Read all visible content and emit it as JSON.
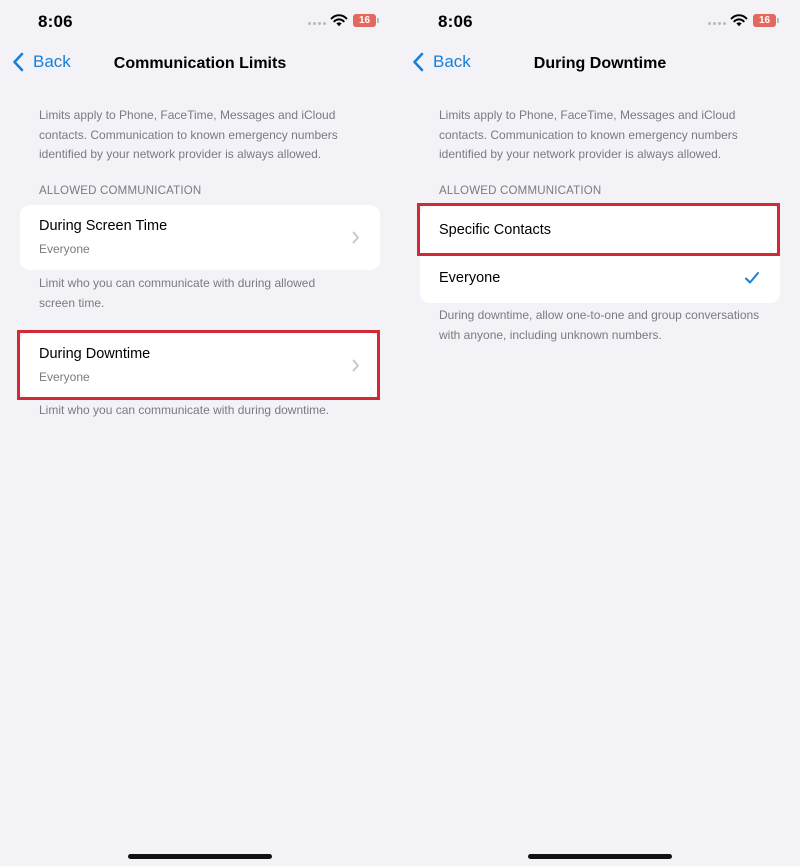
{
  "status_bar": {
    "time": "8:06",
    "battery": "16"
  },
  "left_screen": {
    "nav": {
      "back_label": "Back",
      "title": "Communication Limits"
    },
    "description": "Limits apply to Phone, FaceTime, Messages and iCloud contacts. Communication to known emergency numbers identified by your network provider is always allowed.",
    "section_header": "ALLOWED COMMUNICATION",
    "rows": [
      {
        "title": "During Screen Time",
        "subtitle": "Everyone",
        "footer": "Limit who you can communicate with during allowed screen time."
      },
      {
        "title": "During Downtime",
        "subtitle": "Everyone",
        "footer": "Limit who you can communicate with during downtime."
      }
    ]
  },
  "right_screen": {
    "nav": {
      "back_label": "Back",
      "title": "During Downtime"
    },
    "description": "Limits apply to Phone, FaceTime, Messages and iCloud contacts. Communication to known emergency numbers identified by your network provider is always allowed.",
    "section_header": "ALLOWED COMMUNICATION",
    "options": [
      {
        "label": "Specific Contacts",
        "selected": false
      },
      {
        "label": "Everyone",
        "selected": true
      }
    ],
    "footer": "During downtime, allow one-to-one and group conversations with anyone, including unknown numbers."
  },
  "colors": {
    "accent": "#1a80d6",
    "highlight": "#d22a35",
    "background": "#f2f2f7",
    "secondary_text": "#7a7a80"
  },
  "icons": [
    "back-chevron-icon",
    "wifi-icon",
    "battery-icon",
    "signal-icon",
    "chevron-right-icon",
    "checkmark-icon"
  ]
}
